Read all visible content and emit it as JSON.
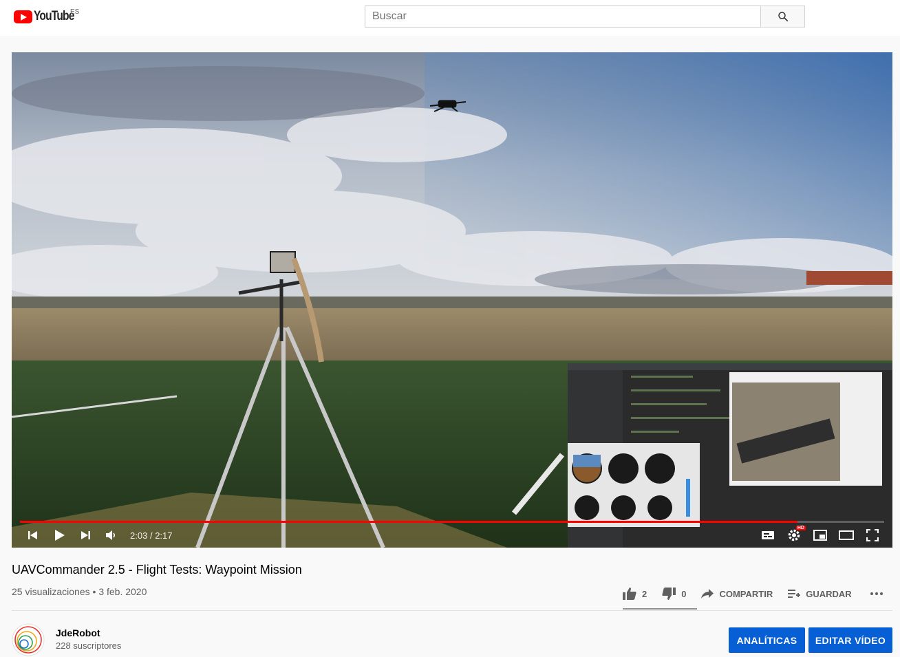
{
  "header": {
    "logo_text": "YouTube",
    "country_code": "ES",
    "search_placeholder": "Buscar",
    "search_icon": "search-icon"
  },
  "player": {
    "time_current": "2:03",
    "time_separator": "/",
    "time_total": "2:17",
    "progress_played_fraction": 0.9,
    "progress_loaded_fraction": 0.9,
    "hd_badge": "HD",
    "icons": [
      "previous-icon",
      "play-icon",
      "next-icon",
      "volume-icon",
      "subtitles-icon",
      "settings-icon",
      "miniplayer-icon",
      "theater-icon",
      "fullscreen-icon"
    ]
  },
  "video": {
    "title": "UAVCommander 2.5 - Flight Tests: Waypoint Mission",
    "views": "25 visualizaciones",
    "separator": "•",
    "date": "3 feb. 2020"
  },
  "actions": {
    "likes": "2",
    "dislikes": "0",
    "share_label": "COMPARTIR",
    "save_label": "GUARDAR"
  },
  "channel": {
    "name": "JdeRobot",
    "subscribers": "228 suscriptores",
    "analytics_label": "ANALÍTICAS",
    "edit_label": "EDITAR VÍDEO"
  },
  "colors": {
    "accent_red": "#ff0000",
    "button_blue": "#065fd4",
    "sky": "#8fa4bf",
    "field_green": "#2f4a26"
  }
}
